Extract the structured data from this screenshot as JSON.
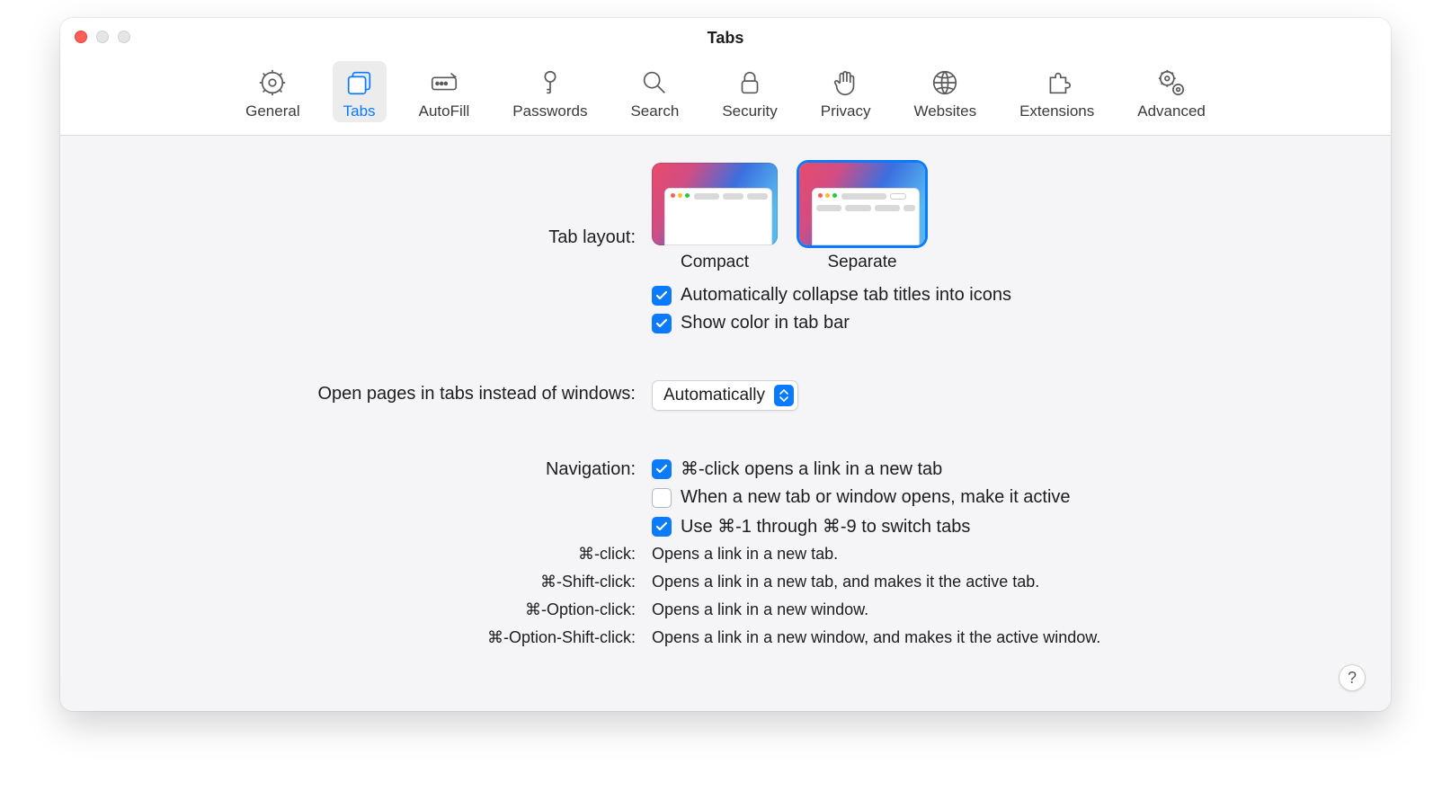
{
  "title": "Tabs",
  "toolbar": [
    {
      "id": "general",
      "label": "General"
    },
    {
      "id": "tabs",
      "label": "Tabs",
      "active": true
    },
    {
      "id": "autofill",
      "label": "AutoFill"
    },
    {
      "id": "passwords",
      "label": "Passwords"
    },
    {
      "id": "search",
      "label": "Search"
    },
    {
      "id": "security",
      "label": "Security"
    },
    {
      "id": "privacy",
      "label": "Privacy"
    },
    {
      "id": "websites",
      "label": "Websites"
    },
    {
      "id": "extensions",
      "label": "Extensions"
    },
    {
      "id": "advanced",
      "label": "Advanced"
    }
  ],
  "labels": {
    "tab_layout": "Tab layout:",
    "open_pages": "Open pages in tabs instead of windows:",
    "navigation": "Navigation:"
  },
  "tab_layout": {
    "compact": "Compact",
    "separate": "Separate",
    "selected": "separate"
  },
  "checkboxes": {
    "collapse": {
      "checked": true,
      "label": "Automatically collapse tab titles into icons"
    },
    "color": {
      "checked": true,
      "label": "Show color in tab bar"
    },
    "cmd_click": {
      "checked": true,
      "label": "⌘-click opens a link in a new tab"
    },
    "make_active": {
      "checked": false,
      "label": "When a new tab or window opens, make it active"
    },
    "switch": {
      "checked": true,
      "label": "Use ⌘-1 through ⌘-9 to switch tabs"
    }
  },
  "dropdown": {
    "value": "Automatically"
  },
  "hints": [
    {
      "keys": "⌘-click:",
      "desc": "Opens a link in a new tab."
    },
    {
      "keys": "⌘-Shift-click:",
      "desc": "Opens a link in a new tab, and makes it the active tab."
    },
    {
      "keys": "⌘-Option-click:",
      "desc": "Opens a link in a new window."
    },
    {
      "keys": "⌘-Option-Shift-click:",
      "desc": "Opens a link in a new window, and makes it the active window."
    }
  ],
  "help": "?"
}
